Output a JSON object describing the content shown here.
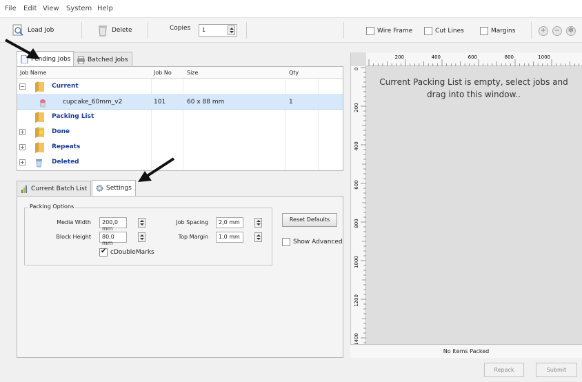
{
  "menu": {
    "items": [
      "File",
      "Edit",
      "View",
      "System",
      "Help"
    ]
  },
  "toolbar": {
    "load_job": "Load Job",
    "delete": "Delete",
    "copies_label": "Copies",
    "copies_value": "1",
    "wire_frame": "Wire Frame",
    "cut_lines": "Cut Lines",
    "margins": "Margins",
    "wire_frame_checked": false,
    "cut_lines_checked": false,
    "margins_checked": false
  },
  "top_tabs": [
    {
      "label": "Pending Jobs",
      "icon": "document-icon",
      "active": true
    },
    {
      "label": "Batched Jobs",
      "icon": "printer-icon",
      "active": false
    }
  ],
  "jobs_table": {
    "headers": [
      "Job Name",
      "Job No",
      "Size",
      "Qty"
    ],
    "rows": [
      {
        "name": "Current",
        "expander": "minus",
        "icon": "folder-icon",
        "job_no": "",
        "size": "",
        "qty": "",
        "selected": false,
        "level": 0
      },
      {
        "name": "cupcake_60mm_v2",
        "expander": "",
        "icon": "cupcake-icon",
        "job_no": "101",
        "size": "60 x 88  mm",
        "qty": "1",
        "selected": true,
        "level": 1
      },
      {
        "name": "Packing List",
        "expander": "",
        "icon": "folder-icon",
        "job_no": "",
        "size": "",
        "qty": "",
        "selected": false,
        "level": 0
      },
      {
        "name": "Done",
        "expander": "plus",
        "icon": "smiley-folder-icon",
        "job_no": "",
        "size": "",
        "qty": "",
        "selected": false,
        "level": 0
      },
      {
        "name": "Repeats",
        "expander": "plus",
        "icon": "folder-icon",
        "job_no": "",
        "size": "",
        "qty": "",
        "selected": false,
        "level": 0
      },
      {
        "name": "Deleted",
        "expander": "plus",
        "icon": "trash-icon",
        "job_no": "",
        "size": "",
        "qty": "",
        "selected": false,
        "level": 0
      }
    ]
  },
  "bottom_tabs": [
    {
      "label": "Current Batch List",
      "icon": "chart-icon",
      "active": false
    },
    {
      "label": "Settings",
      "icon": "gear-icon",
      "active": true
    }
  ],
  "settings": {
    "group_title": "Packing Options",
    "media_width_label": "Media Width",
    "media_width_value": "200,0 mm",
    "block_height_label": "Block Height",
    "block_height_value": "80,0 mm",
    "job_spacing_label": "Job Spacing",
    "job_spacing_value": "2,0 mm",
    "top_margin_label": "Top Margin",
    "top_margin_value": "1,0 mm",
    "double_marks_label": "cDoubleMarks",
    "double_marks_checked": true,
    "reset_defaults": "Reset Defaults",
    "show_advanced": "Show Advanced",
    "show_advanced_checked": false
  },
  "preview": {
    "h_ticks": [
      "200",
      "400",
      "600",
      "800",
      "1000"
    ],
    "v_ticks": [
      "0",
      "200",
      "400",
      "600",
      "800",
      "1000",
      "1200",
      "1400"
    ],
    "empty_message": "Current Packing List is empty, select jobs and drag into this window..",
    "status": "No Items Packed"
  },
  "footer": {
    "repack": "Repack",
    "submit": "Submit"
  },
  "colors": {
    "accent_blue": "#1a3c9a",
    "selection": "#d7e8fa",
    "preview_bg": "#dedede"
  }
}
